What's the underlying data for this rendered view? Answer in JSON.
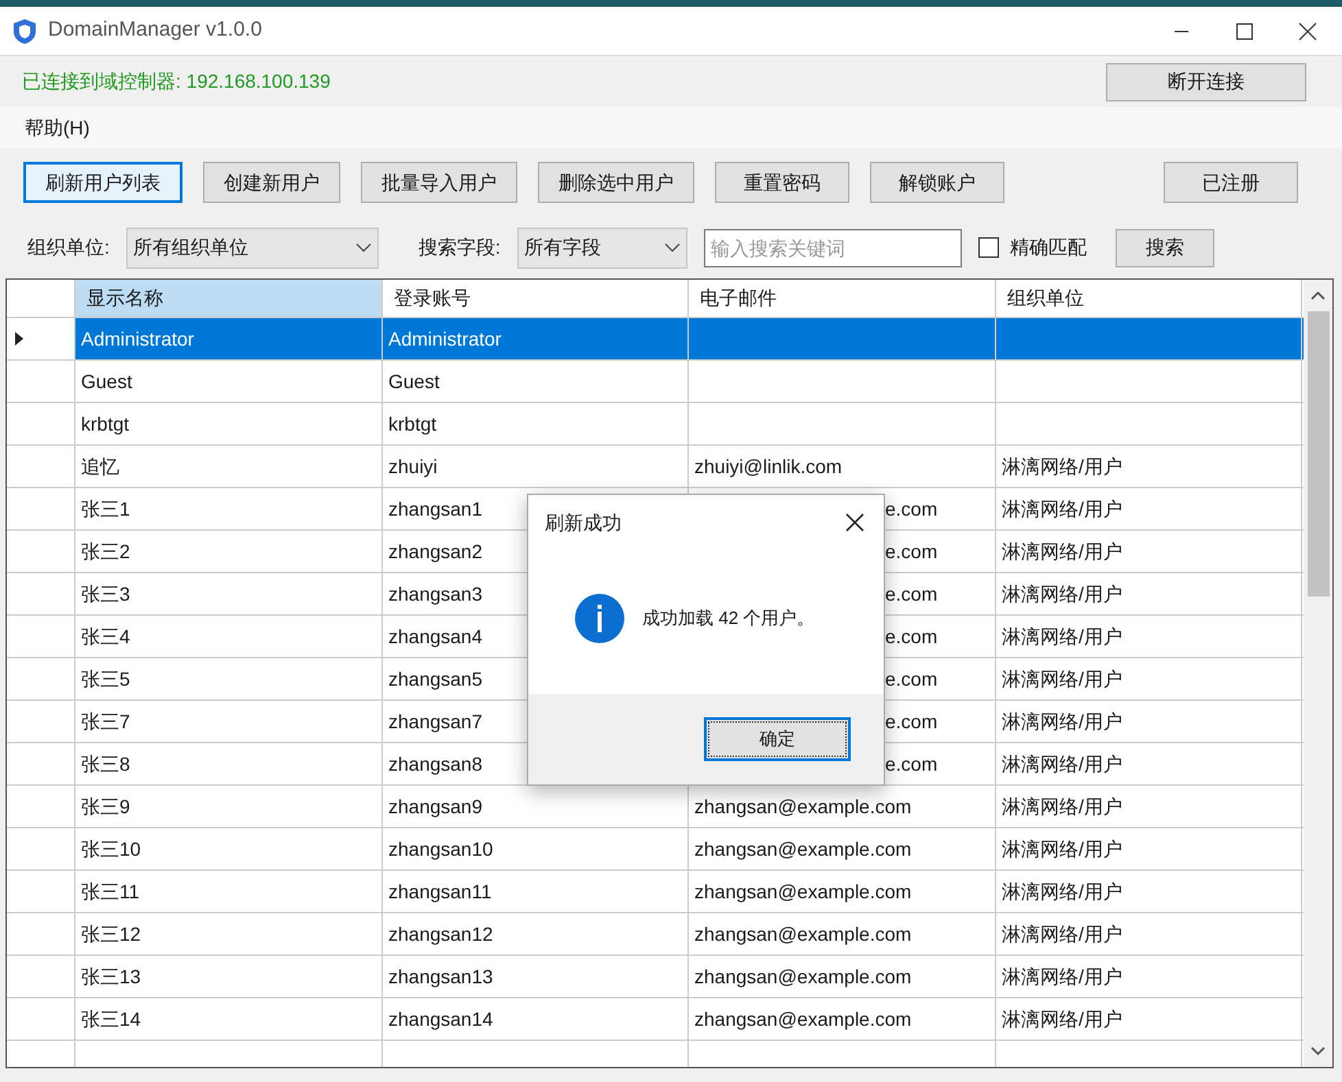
{
  "window": {
    "title": "DomainManager v1.0.0"
  },
  "connection": {
    "status": "已连接到域控制器: 192.168.100.139",
    "button": "断开连接"
  },
  "menu": [
    "帮助(H)"
  ],
  "toolbar": [
    {
      "label": "刷新用户列表",
      "focused": true
    },
    {
      "label": "创建新用户",
      "focused": false
    },
    {
      "label": "批量导入用户",
      "focused": false
    },
    {
      "label": "删除选中用户",
      "focused": false
    },
    {
      "label": "重置密码",
      "focused": false
    },
    {
      "label": "解锁账户",
      "focused": false
    }
  ],
  "registered_button": "已注册",
  "filters": {
    "ou_label": "组织单位:",
    "ou_value": "所有组织单位",
    "field_label": "搜索字段:",
    "field_value": "所有字段",
    "search_placeholder": "输入搜索关键词",
    "exact_match": {
      "label": "精确匹配",
      "checked": false
    },
    "search_button": "搜索"
  },
  "table": {
    "columns": [
      "显示名称",
      "登录账号",
      "电子邮件",
      "组织单位"
    ],
    "rows": [
      {
        "selected": true,
        "cells": [
          "Administrator",
          "Administrator",
          "",
          ""
        ]
      },
      {
        "selected": false,
        "cells": [
          "Guest",
          "Guest",
          "",
          ""
        ]
      },
      {
        "selected": false,
        "cells": [
          "krbtgt",
          "krbtgt",
          "",
          ""
        ]
      },
      {
        "selected": false,
        "cells": [
          "追忆",
          "zhuiyi",
          "zhuiyi@linlik.com",
          "淋漓网络/用户"
        ]
      },
      {
        "selected": false,
        "covered": true,
        "cells": [
          "张三1",
          "zhangsan1",
          "e.com",
          "淋漓网络/用户"
        ]
      },
      {
        "selected": false,
        "covered": true,
        "cells": [
          "张三2",
          "zhangsan2",
          "e.com",
          "淋漓网络/用户"
        ]
      },
      {
        "selected": false,
        "covered": true,
        "cells": [
          "张三3",
          "zhangsan3",
          "e.com",
          "淋漓网络/用户"
        ]
      },
      {
        "selected": false,
        "covered": true,
        "cells": [
          "张三4",
          "zhangsan4",
          "e.com",
          "淋漓网络/用户"
        ]
      },
      {
        "selected": false,
        "covered": true,
        "cells": [
          "张三5",
          "zhangsan5",
          "e.com",
          "淋漓网络/用户"
        ]
      },
      {
        "selected": false,
        "covered": true,
        "cells": [
          "张三7",
          "zhangsan7",
          "e.com",
          "淋漓网络/用户"
        ]
      },
      {
        "selected": false,
        "covered": true,
        "cells": [
          "张三8",
          "zhangsan8",
          "e.com",
          "淋漓网络/用户"
        ]
      },
      {
        "selected": false,
        "cells": [
          "张三9",
          "zhangsan9",
          "zhangsan@example.com",
          "淋漓网络/用户"
        ]
      },
      {
        "selected": false,
        "cells": [
          "张三10",
          "zhangsan10",
          "zhangsan@example.com",
          "淋漓网络/用户"
        ]
      },
      {
        "selected": false,
        "cells": [
          "张三11",
          "zhangsan11",
          "zhangsan@example.com",
          "淋漓网络/用户"
        ]
      },
      {
        "selected": false,
        "cells": [
          "张三12",
          "zhangsan12",
          "zhangsan@example.com",
          "淋漓网络/用户"
        ]
      },
      {
        "selected": false,
        "cells": [
          "张三13",
          "zhangsan13",
          "zhangsan@example.com",
          "淋漓网络/用户"
        ]
      },
      {
        "selected": false,
        "cells": [
          "张三14",
          "zhangsan14",
          "zhangsan@example.com",
          "淋漓网络/用户"
        ]
      }
    ]
  },
  "dialog": {
    "title": "刷新成功",
    "message": "成功加载 42 个用户。",
    "button": "确定"
  }
}
